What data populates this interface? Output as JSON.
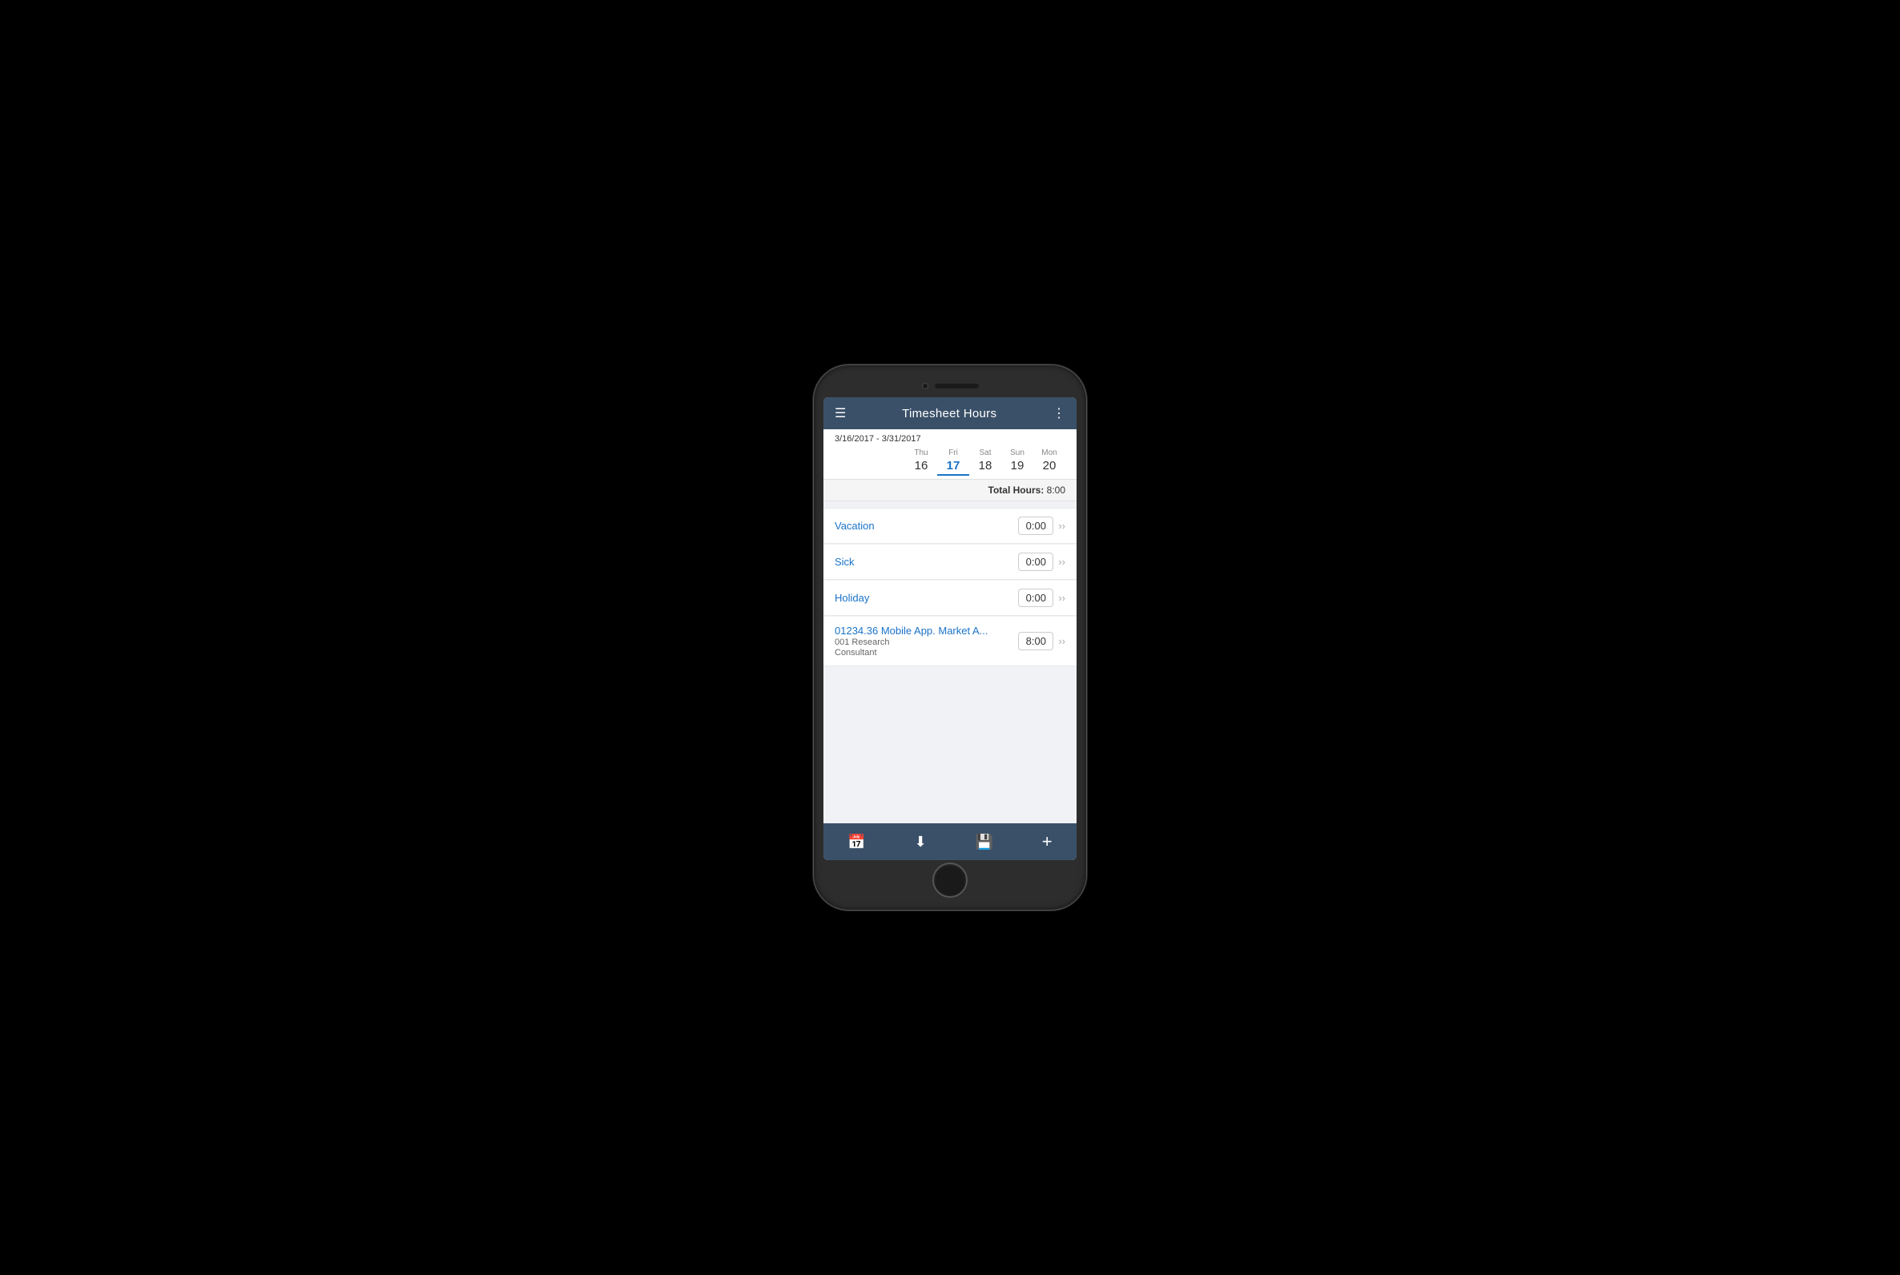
{
  "header": {
    "menu_label": "☰",
    "title": "Timesheet Hours",
    "more_label": "⋮"
  },
  "date_range": {
    "text": "3/16/2017 - 3/31/2017"
  },
  "days": [
    {
      "name": "Thu",
      "num": "16",
      "active": false
    },
    {
      "name": "Fri",
      "num": "17",
      "active": true
    },
    {
      "name": "Sat",
      "num": "18",
      "active": false
    },
    {
      "name": "Sun",
      "num": "19",
      "active": false
    },
    {
      "name": "Mon",
      "num": "20",
      "active": false
    }
  ],
  "total_hours_label": "Total Hours:",
  "total_hours_value": "8:00",
  "entries": [
    {
      "label": "Vacation",
      "sublabel": "",
      "sublabel2": "",
      "time": "0:00"
    },
    {
      "label": "Sick",
      "sublabel": "",
      "sublabel2": "",
      "time": "0:00"
    },
    {
      "label": "Holiday",
      "sublabel": "",
      "sublabel2": "",
      "time": "0:00"
    },
    {
      "label": "01234.36 Mobile App. Market A...",
      "sublabel": "001 Research",
      "sublabel2": "Consultant",
      "time": "8:00"
    }
  ],
  "toolbar": {
    "calendar_label": "📅",
    "download_label": "⬇",
    "save_label": "💾",
    "add_label": "+"
  }
}
